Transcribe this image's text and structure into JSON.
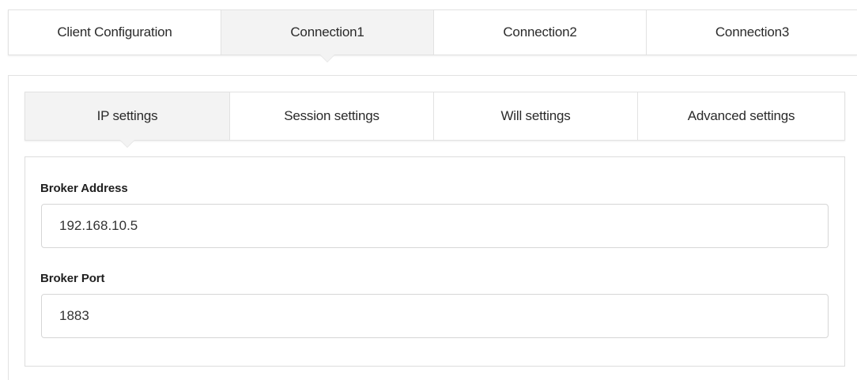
{
  "top_tabs": {
    "items": [
      {
        "label": "Client Configuration"
      },
      {
        "label": "Connection1"
      },
      {
        "label": "Connection2"
      },
      {
        "label": "Connection3"
      }
    ],
    "active_index": 1
  },
  "sub_tabs": {
    "items": [
      {
        "label": "IP settings"
      },
      {
        "label": "Session settings"
      },
      {
        "label": "Will settings"
      },
      {
        "label": "Advanced settings"
      }
    ],
    "active_index": 0
  },
  "form": {
    "broker_address": {
      "label": "Broker Address",
      "value": "192.168.10.5"
    },
    "broker_port": {
      "label": "Broker Port",
      "value": "1883"
    }
  }
}
